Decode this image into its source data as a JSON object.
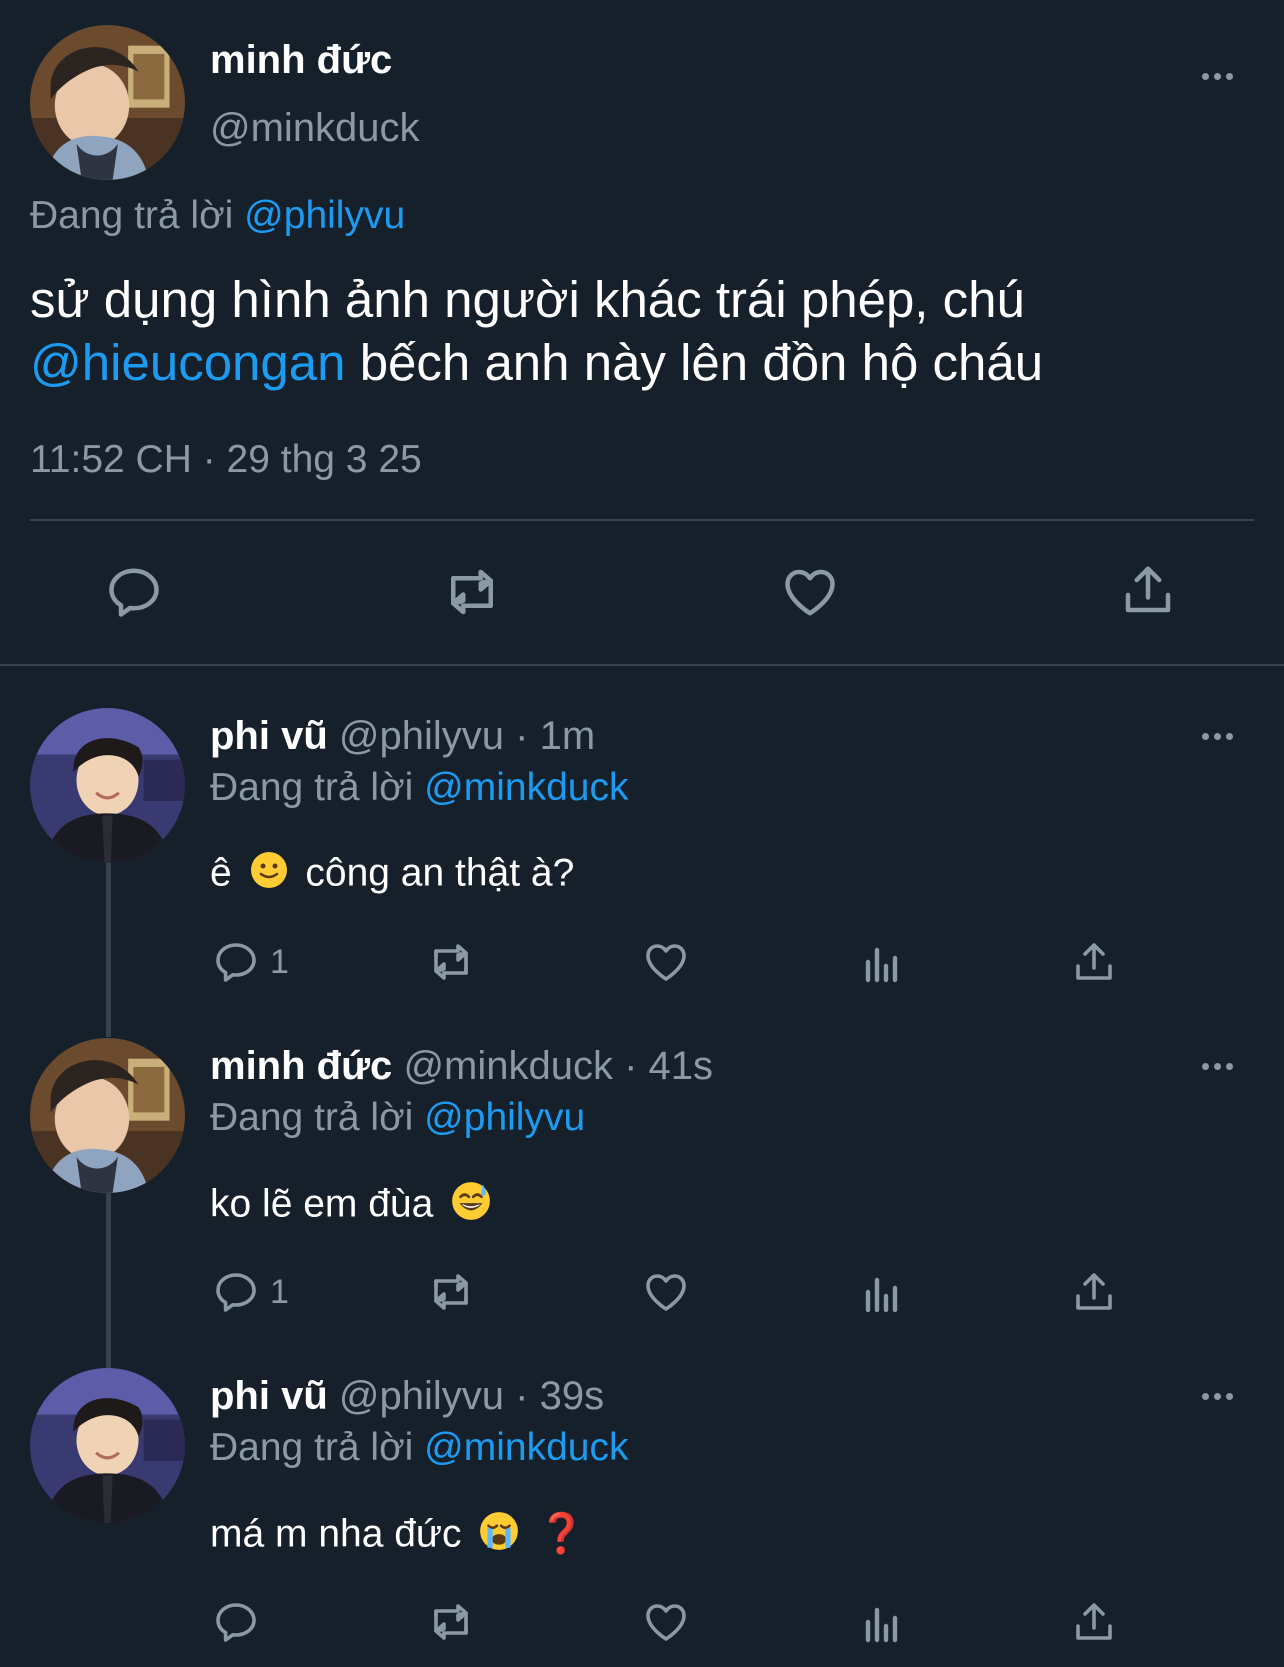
{
  "main_tweet": {
    "display_name": "minh đức",
    "handle": "@minkduck",
    "replying_prefix": "Đang trả lời",
    "replying_to": "@philyvu",
    "text_line1": "sử dụng hình ảnh người khác trái phép, chú",
    "mention": "@hieucongan",
    "text_line2_rest": "bếch anh này lên đồn hộ cháu",
    "timestamp": "11:52 CH · 29 thg 3 25"
  },
  "replies": [
    {
      "display_name": "phi vũ",
      "meta": "@philyvu · 1m",
      "replying_prefix": "Đang trả lời",
      "replying_to": "@minkduck",
      "text_before": "ê",
      "emoji": "slightly-smiling-face",
      "text_after": "công an thật à?",
      "reply_count": "1"
    },
    {
      "display_name": "minh đức",
      "meta": "@minkduck · 41s",
      "replying_prefix": "Đang trả lời",
      "replying_to": "@philyvu",
      "text_before": "ko lẽ em đùa",
      "emoji": "grinning-face-with-sweat",
      "text_after": "",
      "reply_count": "1"
    },
    {
      "display_name": "phi vũ",
      "meta": "@philyvu · 39s",
      "replying_prefix": "Đang trả lời",
      "replying_to": "@minkduck",
      "text_before": "má m nha đức",
      "emoji": "loudly-crying-face",
      "text_after": "❓",
      "reply_count": ""
    }
  ],
  "colors": {
    "background": "#15202b",
    "link": "#1d9bf0",
    "muted": "#8b98a5",
    "divider": "#38444d"
  }
}
